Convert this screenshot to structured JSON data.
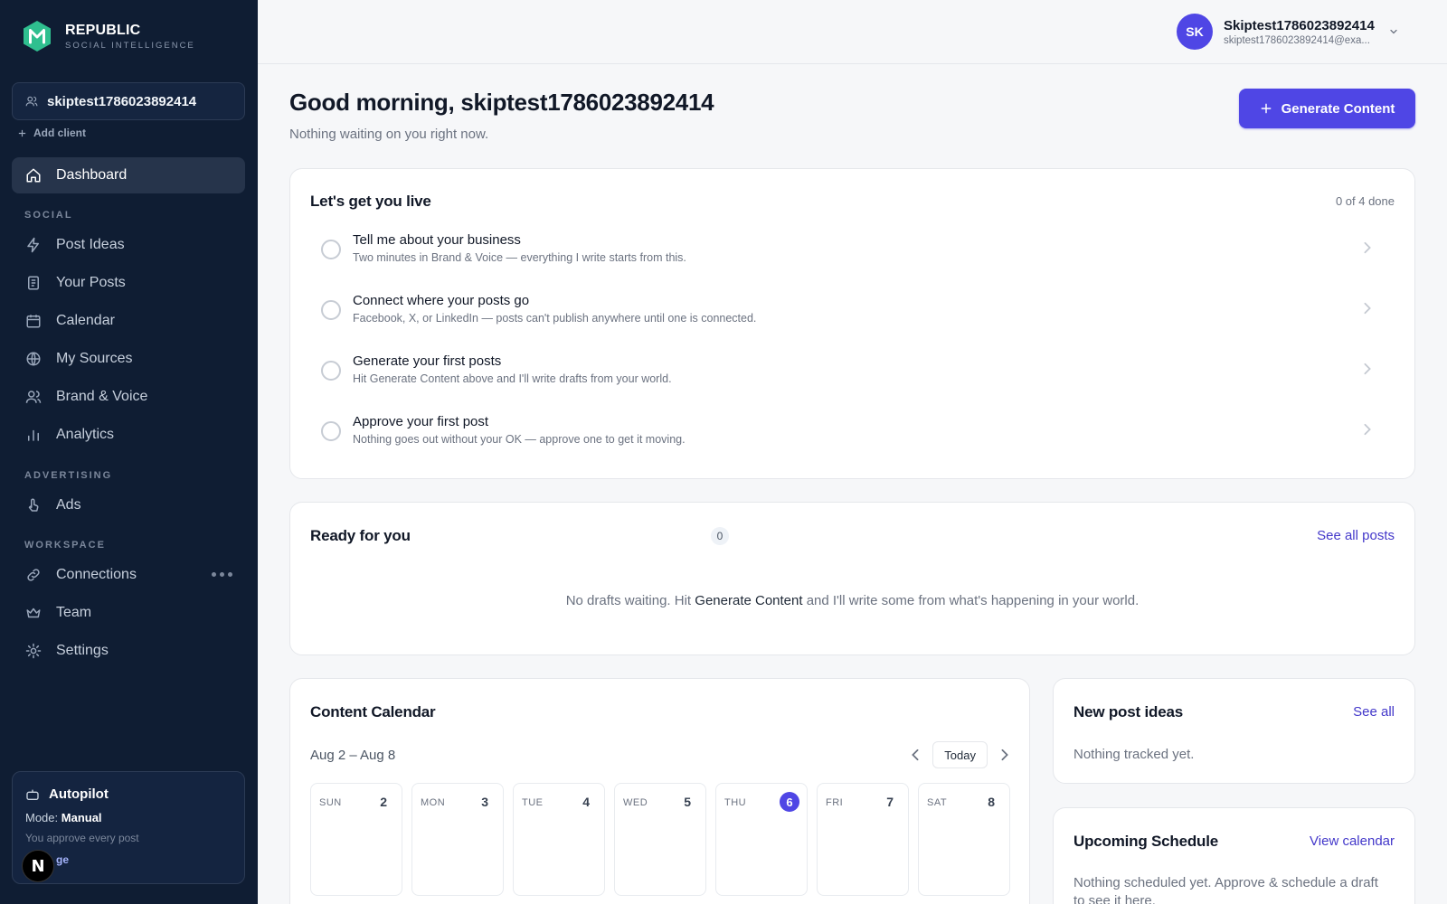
{
  "app": {
    "brand": "REPUBLIC",
    "tagline": "SOCIAL INTELLIGENCE",
    "colors": {
      "sidebar": "#0f1d33",
      "accent": "#4f46e5",
      "logo": "#2fbf8f"
    }
  },
  "sidebar": {
    "client_name": "skiptest1786023892414",
    "add_client": "Add client",
    "dashboard": "Dashboard",
    "section_social": "SOCIAL",
    "post_ideas": "Post Ideas",
    "your_posts": "Your Posts",
    "calendar": "Calendar",
    "my_sources": "My Sources",
    "brand_voice": "Brand & Voice",
    "analytics": "Analytics",
    "section_advertising": "ADVERTISING",
    "ads": "Ads",
    "section_workspace": "WORKSPACE",
    "connections": "Connections",
    "team": "Team",
    "settings": "Settings",
    "autopilot": {
      "title": "Autopilot",
      "mode_label": "Mode:",
      "mode_value": "Manual",
      "description": "You approve every post",
      "link": "ge"
    },
    "n_badge": "N"
  },
  "topbar": {
    "avatar_initials": "SK",
    "user_name": "Skiptest1786023892414",
    "user_email": "skiptest1786023892414@exa..."
  },
  "main": {
    "greeting": "Good morning, skiptest1786023892414",
    "subgreeting": "Nothing waiting on you right now.",
    "generate_button": "Generate Content"
  },
  "checklist": {
    "title": "Let's get you live",
    "progress": "0 of 4 done",
    "tasks": [
      {
        "title": "Tell me about your business",
        "desc": "Two minutes in Brand & Voice — everything I write starts from this."
      },
      {
        "title": "Connect where your posts go",
        "desc": "Facebook, X, or LinkedIn — posts can't publish anywhere until one is connected."
      },
      {
        "title": "Generate your first posts",
        "desc": "Hit Generate Content above and I'll write drafts from your world."
      },
      {
        "title": "Approve your first post",
        "desc": "Nothing goes out without your OK — approve one to get it moving."
      }
    ]
  },
  "ready": {
    "title": "Ready for you",
    "count": "0",
    "link": "See all posts",
    "empty_pre": "No drafts waiting. Hit ",
    "empty_strong": "Generate Content",
    "empty_post": " and I'll write some from what's happening in your world."
  },
  "content_calendar": {
    "title": "Content Calendar",
    "range": "Aug 2 – Aug 8",
    "today": "Today",
    "days": [
      {
        "dow": "SUN",
        "num": "2"
      },
      {
        "dow": "MON",
        "num": "3"
      },
      {
        "dow": "TUE",
        "num": "4"
      },
      {
        "dow": "WED",
        "num": "5"
      },
      {
        "dow": "THU",
        "num": "6"
      },
      {
        "dow": "FRI",
        "num": "7"
      },
      {
        "dow": "SAT",
        "num": "8"
      }
    ]
  },
  "new_ideas": {
    "title": "New post ideas",
    "link": "See all",
    "empty": "Nothing tracked yet."
  },
  "upcoming": {
    "title": "Upcoming Schedule",
    "link": "View calendar",
    "empty": "Nothing scheduled yet. Approve & schedule a draft to see it here."
  }
}
